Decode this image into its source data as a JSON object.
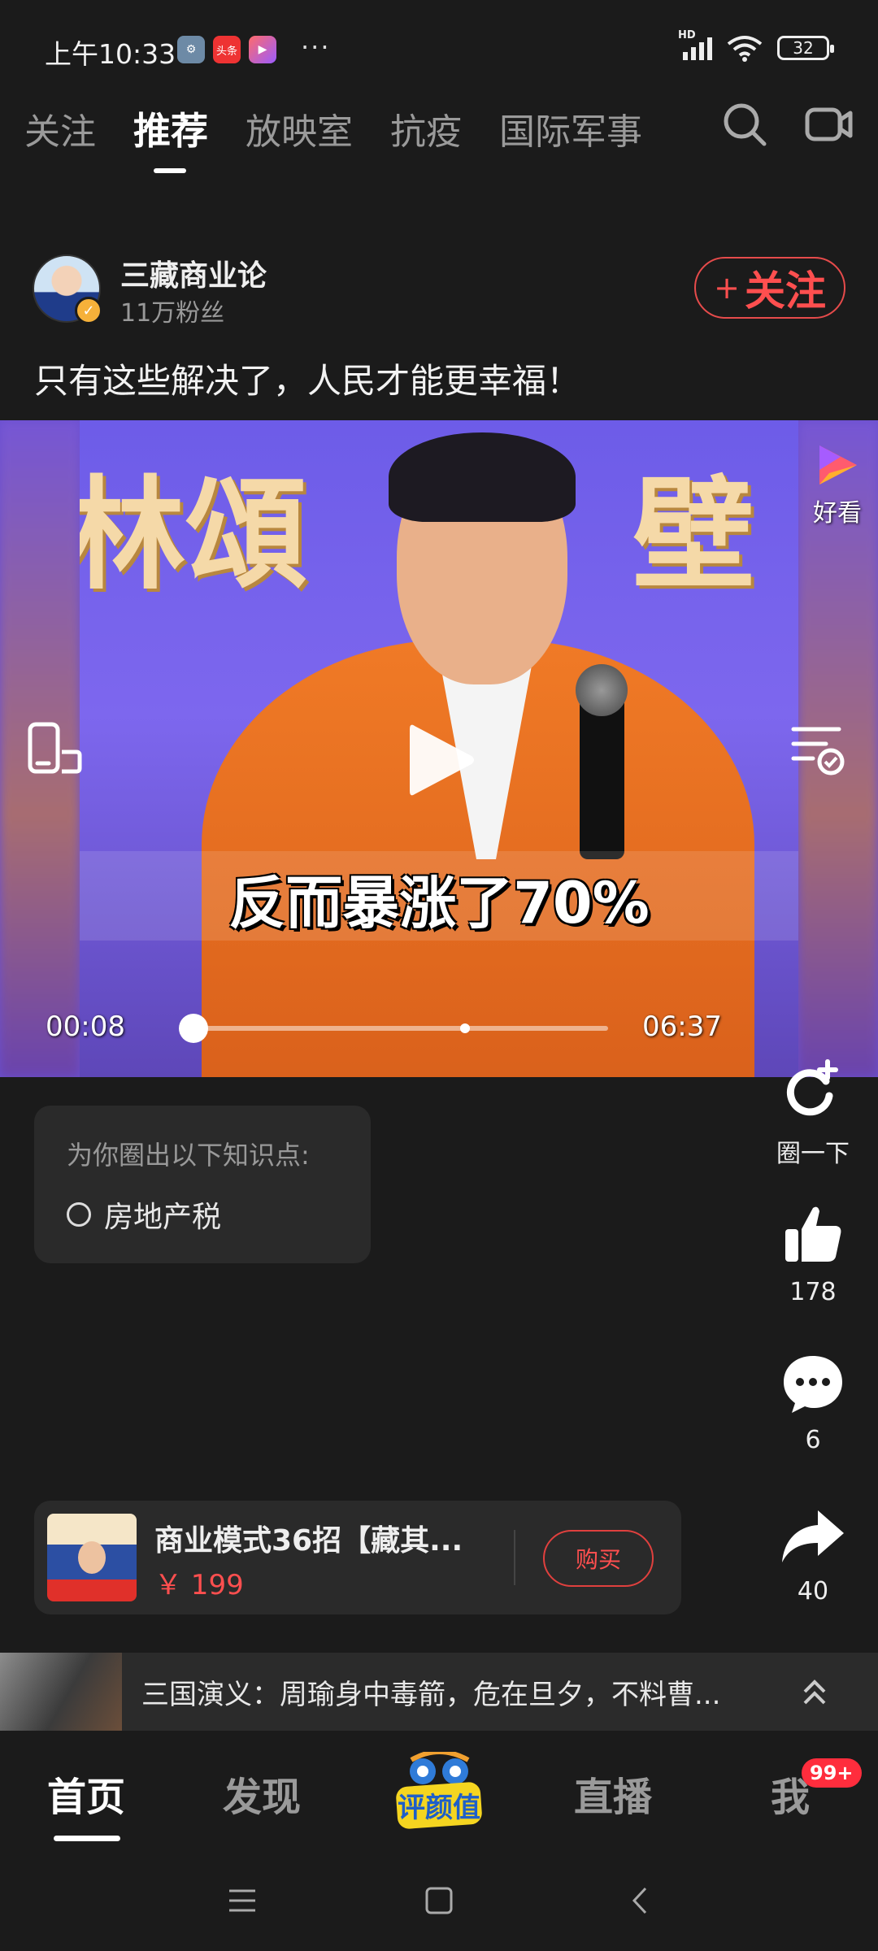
{
  "status_bar": {
    "time": "上午10:33",
    "app_icons": [
      "settings-app-icon",
      "toutiao-app-icon",
      "haokan-app-icon"
    ],
    "toutiao_label": "头条",
    "more": "···",
    "network": "HD",
    "battery": "32"
  },
  "top_tabs": [
    {
      "label": "关注",
      "active": false
    },
    {
      "label": "推荐",
      "active": true
    },
    {
      "label": "放映室",
      "active": false
    },
    {
      "label": "抗疫",
      "active": false
    },
    {
      "label": "国际军事",
      "active": false
    }
  ],
  "top_icons": [
    "search-icon",
    "video-camera-icon"
  ],
  "author": {
    "name": "三藏商业论",
    "fans": "11万粉丝",
    "follow_label": "关注",
    "follow_plus": "+"
  },
  "post": {
    "title": "只有这些解决了，人民才能更幸福！"
  },
  "video": {
    "subtitle": "反而暴涨了70%",
    "banner_text_left": "林頌",
    "banner_text_right": "壁",
    "watermark_label": "好看",
    "current_time": "00:08",
    "total_time": "06:37",
    "progress_fraction": 0.02
  },
  "knowledge": {
    "title": "为你圈出以下知识点:",
    "items": [
      "房地产税"
    ]
  },
  "actions": {
    "circle_label": "圈一下",
    "like_count": "178",
    "comment_count": "6",
    "share_count": "40"
  },
  "product": {
    "title": "商业模式36招【藏其...",
    "price": "￥ 199",
    "buy_label": "购买"
  },
  "next_video": {
    "text": "三国演义：周瑜身中毒箭，危在旦夕，不料曹..."
  },
  "bottom_nav": {
    "items": [
      "首页",
      "发现",
      "直播",
      "我"
    ],
    "active": "首页",
    "logo_text": "评颜值",
    "badge": "99+"
  },
  "colors": {
    "background": "#1b1b1b",
    "accent_red": "#ff4f4f",
    "card": "#2a2a2a"
  }
}
